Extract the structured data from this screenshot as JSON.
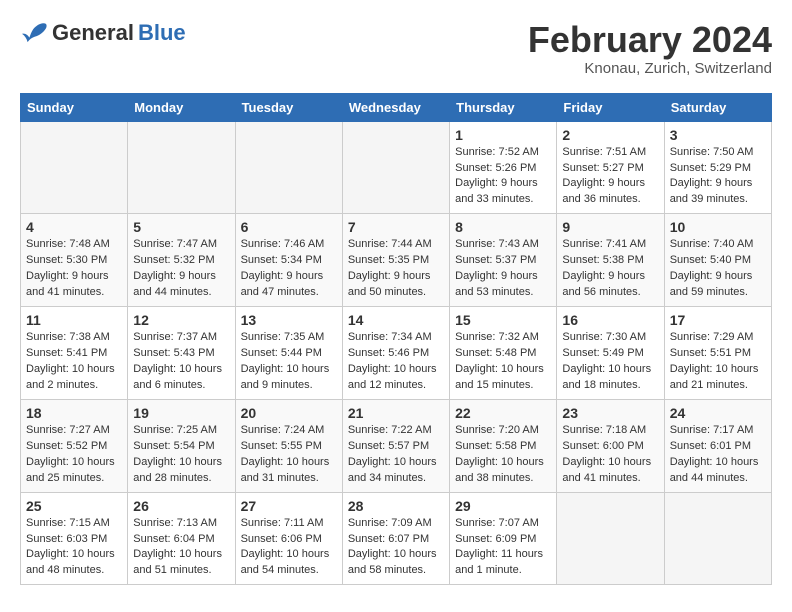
{
  "header": {
    "logo_general": "General",
    "logo_blue": "Blue",
    "month_title": "February 2024",
    "location": "Knonau, Zurich, Switzerland"
  },
  "days_of_week": [
    "Sunday",
    "Monday",
    "Tuesday",
    "Wednesday",
    "Thursday",
    "Friday",
    "Saturday"
  ],
  "weeks": [
    [
      {
        "day": "",
        "info": ""
      },
      {
        "day": "",
        "info": ""
      },
      {
        "day": "",
        "info": ""
      },
      {
        "day": "",
        "info": ""
      },
      {
        "day": "1",
        "info": "Sunrise: 7:52 AM\nSunset: 5:26 PM\nDaylight: 9 hours\nand 33 minutes."
      },
      {
        "day": "2",
        "info": "Sunrise: 7:51 AM\nSunset: 5:27 PM\nDaylight: 9 hours\nand 36 minutes."
      },
      {
        "day": "3",
        "info": "Sunrise: 7:50 AM\nSunset: 5:29 PM\nDaylight: 9 hours\nand 39 minutes."
      }
    ],
    [
      {
        "day": "4",
        "info": "Sunrise: 7:48 AM\nSunset: 5:30 PM\nDaylight: 9 hours\nand 41 minutes."
      },
      {
        "day": "5",
        "info": "Sunrise: 7:47 AM\nSunset: 5:32 PM\nDaylight: 9 hours\nand 44 minutes."
      },
      {
        "day": "6",
        "info": "Sunrise: 7:46 AM\nSunset: 5:34 PM\nDaylight: 9 hours\nand 47 minutes."
      },
      {
        "day": "7",
        "info": "Sunrise: 7:44 AM\nSunset: 5:35 PM\nDaylight: 9 hours\nand 50 minutes."
      },
      {
        "day": "8",
        "info": "Sunrise: 7:43 AM\nSunset: 5:37 PM\nDaylight: 9 hours\nand 53 minutes."
      },
      {
        "day": "9",
        "info": "Sunrise: 7:41 AM\nSunset: 5:38 PM\nDaylight: 9 hours\nand 56 minutes."
      },
      {
        "day": "10",
        "info": "Sunrise: 7:40 AM\nSunset: 5:40 PM\nDaylight: 9 hours\nand 59 minutes."
      }
    ],
    [
      {
        "day": "11",
        "info": "Sunrise: 7:38 AM\nSunset: 5:41 PM\nDaylight: 10 hours\nand 2 minutes."
      },
      {
        "day": "12",
        "info": "Sunrise: 7:37 AM\nSunset: 5:43 PM\nDaylight: 10 hours\nand 6 minutes."
      },
      {
        "day": "13",
        "info": "Sunrise: 7:35 AM\nSunset: 5:44 PM\nDaylight: 10 hours\nand 9 minutes."
      },
      {
        "day": "14",
        "info": "Sunrise: 7:34 AM\nSunset: 5:46 PM\nDaylight: 10 hours\nand 12 minutes."
      },
      {
        "day": "15",
        "info": "Sunrise: 7:32 AM\nSunset: 5:48 PM\nDaylight: 10 hours\nand 15 minutes."
      },
      {
        "day": "16",
        "info": "Sunrise: 7:30 AM\nSunset: 5:49 PM\nDaylight: 10 hours\nand 18 minutes."
      },
      {
        "day": "17",
        "info": "Sunrise: 7:29 AM\nSunset: 5:51 PM\nDaylight: 10 hours\nand 21 minutes."
      }
    ],
    [
      {
        "day": "18",
        "info": "Sunrise: 7:27 AM\nSunset: 5:52 PM\nDaylight: 10 hours\nand 25 minutes."
      },
      {
        "day": "19",
        "info": "Sunrise: 7:25 AM\nSunset: 5:54 PM\nDaylight: 10 hours\nand 28 minutes."
      },
      {
        "day": "20",
        "info": "Sunrise: 7:24 AM\nSunset: 5:55 PM\nDaylight: 10 hours\nand 31 minutes."
      },
      {
        "day": "21",
        "info": "Sunrise: 7:22 AM\nSunset: 5:57 PM\nDaylight: 10 hours\nand 34 minutes."
      },
      {
        "day": "22",
        "info": "Sunrise: 7:20 AM\nSunset: 5:58 PM\nDaylight: 10 hours\nand 38 minutes."
      },
      {
        "day": "23",
        "info": "Sunrise: 7:18 AM\nSunset: 6:00 PM\nDaylight: 10 hours\nand 41 minutes."
      },
      {
        "day": "24",
        "info": "Sunrise: 7:17 AM\nSunset: 6:01 PM\nDaylight: 10 hours\nand 44 minutes."
      }
    ],
    [
      {
        "day": "25",
        "info": "Sunrise: 7:15 AM\nSunset: 6:03 PM\nDaylight: 10 hours\nand 48 minutes."
      },
      {
        "day": "26",
        "info": "Sunrise: 7:13 AM\nSunset: 6:04 PM\nDaylight: 10 hours\nand 51 minutes."
      },
      {
        "day": "27",
        "info": "Sunrise: 7:11 AM\nSunset: 6:06 PM\nDaylight: 10 hours\nand 54 minutes."
      },
      {
        "day": "28",
        "info": "Sunrise: 7:09 AM\nSunset: 6:07 PM\nDaylight: 10 hours\nand 58 minutes."
      },
      {
        "day": "29",
        "info": "Sunrise: 7:07 AM\nSunset: 6:09 PM\nDaylight: 11 hours\nand 1 minute."
      },
      {
        "day": "",
        "info": ""
      },
      {
        "day": "",
        "info": ""
      }
    ]
  ]
}
